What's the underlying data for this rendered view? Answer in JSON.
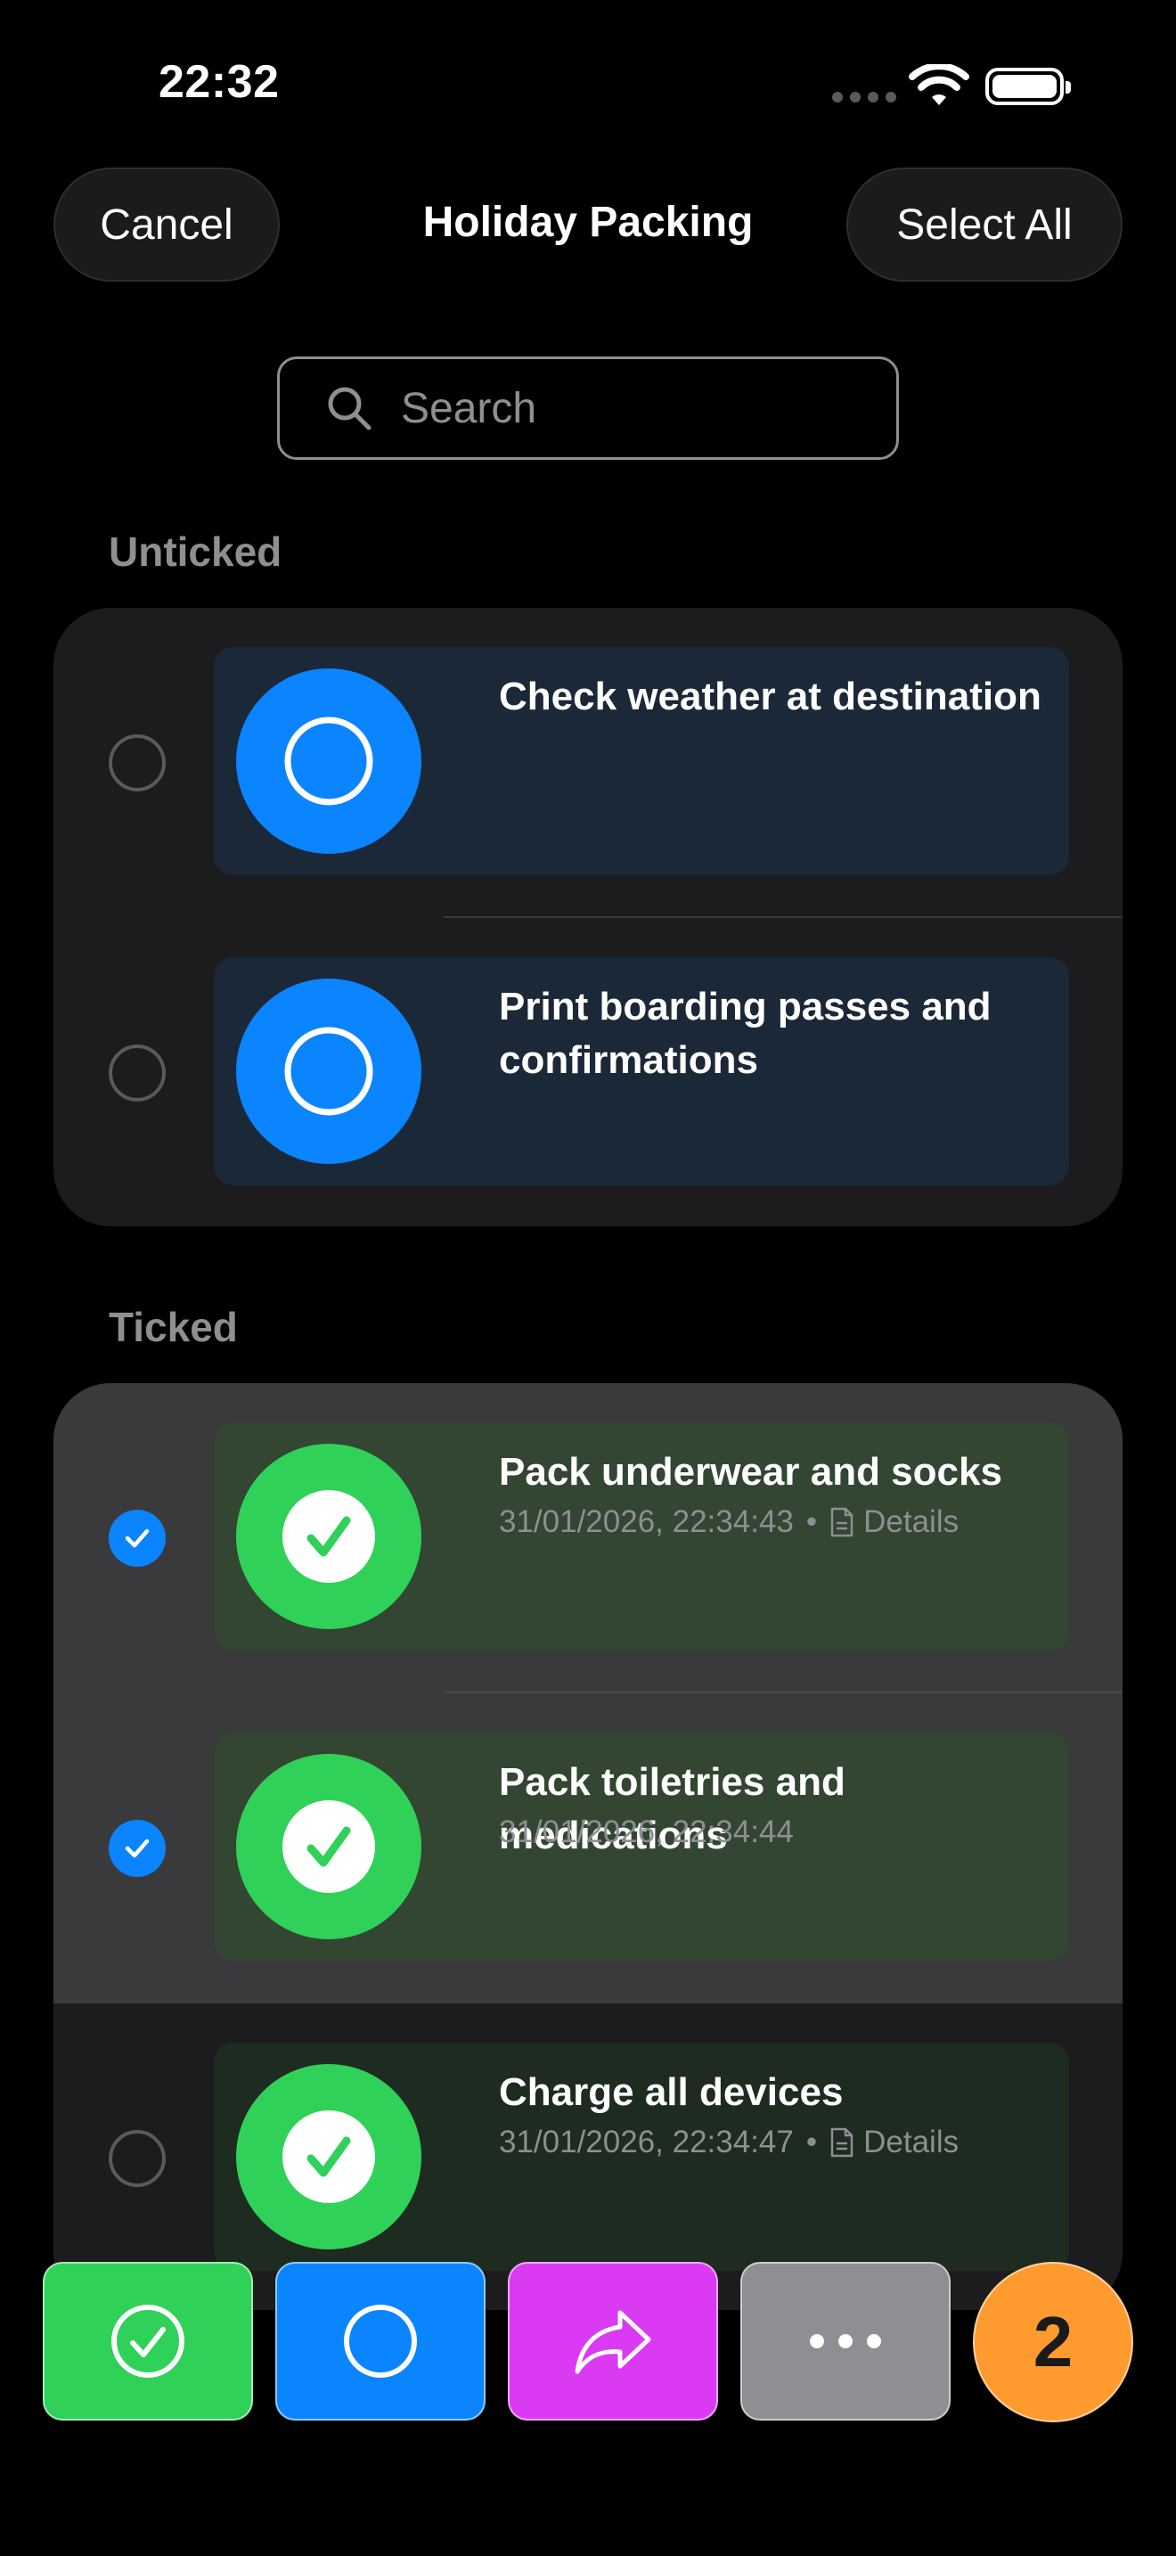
{
  "status_bar": {
    "time": "22:32"
  },
  "nav": {
    "cancel_label": "Cancel",
    "title": "Holiday Packing",
    "select_all_label": "Select All"
  },
  "search": {
    "placeholder": "Search"
  },
  "sections": {
    "unticked": {
      "header": "Unticked",
      "items": [
        {
          "title": "Check weather at destination",
          "selected": false
        },
        {
          "title": "Print boarding passes and confirmations",
          "selected": false
        }
      ]
    },
    "ticked": {
      "header": "Ticked",
      "items": [
        {
          "title": "Pack underwear and socks",
          "timestamp": "31/01/2026, 22:34:43",
          "separator": "•",
          "details_label": "Details",
          "selected": true
        },
        {
          "title": "Pack toiletries and medications",
          "timestamp": "31/01/2026, 22:34:44",
          "selected": true
        },
        {
          "title": "Charge all devices",
          "timestamp": "31/01/2026, 22:34:47",
          "separator": "•",
          "details_label": "Details",
          "selected": false
        }
      ]
    }
  },
  "toolbar": {
    "tick_icon": "checkmark-circle-icon",
    "untick_icon": "circle-icon",
    "share_icon": "share-arrow-icon",
    "more_icon": "ellipsis-icon",
    "selected_count": "2"
  },
  "colors": {
    "accent_blue": "#0a84ff",
    "tick_green": "#30d158",
    "share_purple": "#da3bf2",
    "more_gray": "#8e8e93",
    "count_orange": "#ff9a2e"
  }
}
